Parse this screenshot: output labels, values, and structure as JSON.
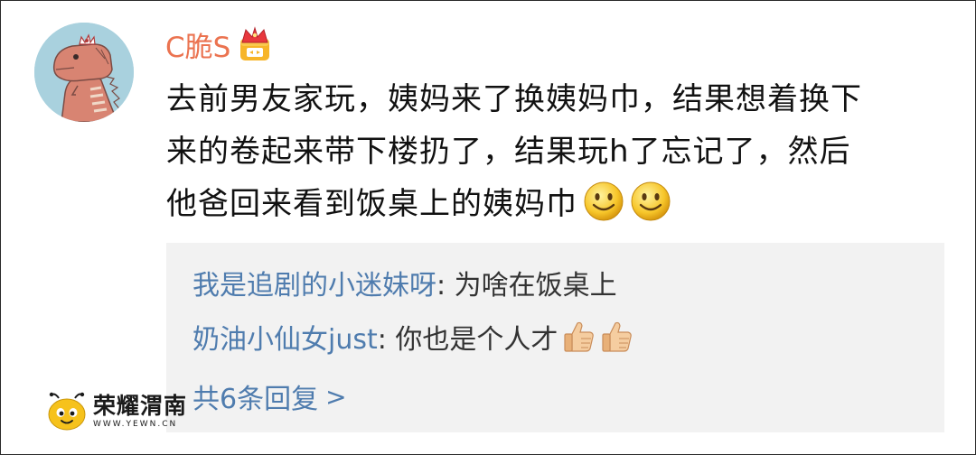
{
  "post": {
    "username": "C脆S",
    "username_badge_icon": "crown-badge-icon",
    "comment_lines": [
      "去前男友家玩，姨妈来了换姨妈巾，结果想着换下",
      "来的卷起来带下楼扔了，结果玩h了忘记了，然后",
      "他爸回来看到饭桌上的姨妈巾"
    ],
    "comment_trailing_emojis": [
      "smile-emoji",
      "smile-emoji"
    ]
  },
  "replies": {
    "items": [
      {
        "author": "我是追剧的小迷妹呀",
        "separator": ": ",
        "text": "为啥在饭桌上"
      },
      {
        "author": "奶油小仙女just",
        "separator": ": ",
        "text": "你也是个人才",
        "emojis": [
          "thumbs-up-emoji",
          "thumbs-up-emoji"
        ]
      }
    ],
    "more_label": "共6条回复",
    "more_chevron": ">"
  },
  "watermark": {
    "title": "荣耀渭南",
    "url": "WWW.YEWN.CN"
  },
  "colors": {
    "username": "#eb7350",
    "reply_author": "#4f7cae",
    "replies_bg": "#f2f2f2",
    "avatar_bg": "#a9d1de"
  }
}
